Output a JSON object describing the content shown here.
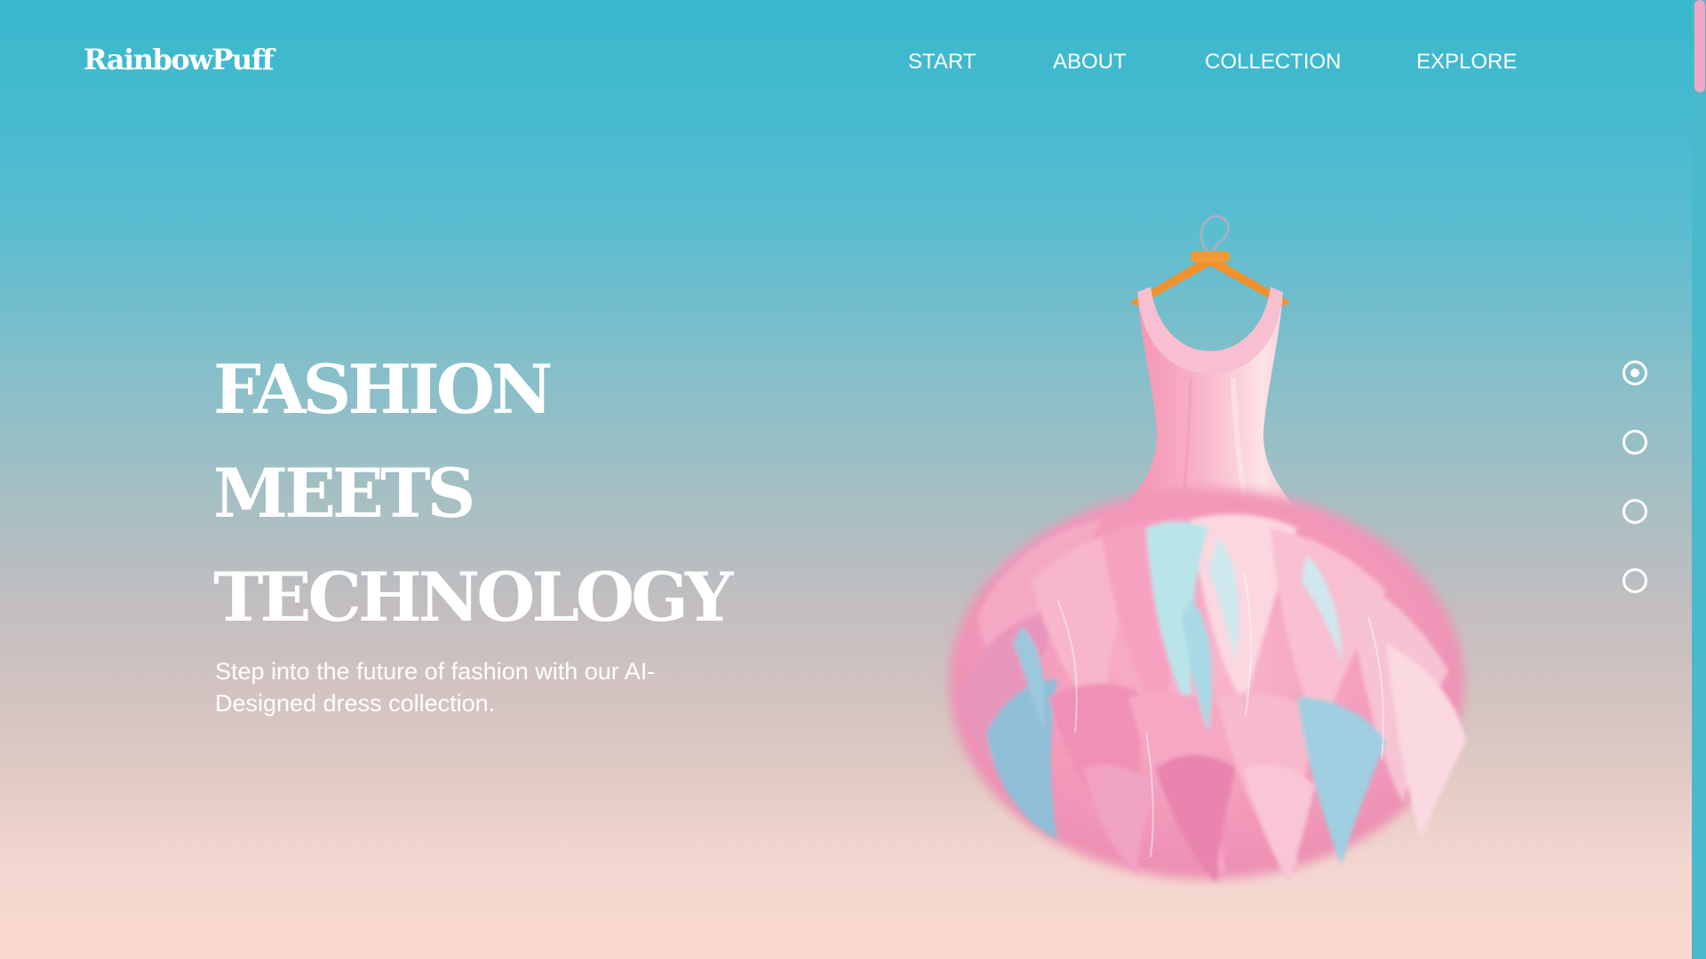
{
  "brand": {
    "name": "RainbowPuff"
  },
  "nav": {
    "items": [
      {
        "label": "START"
      },
      {
        "label": "ABOUT"
      },
      {
        "label": "COLLECTION"
      },
      {
        "label": "EXPLORE"
      }
    ]
  },
  "hero": {
    "headline_lines": [
      "FASHION",
      "MEETS",
      "TECHNOLOGY"
    ],
    "subtitle": "Step into the future of fashion with our AI-Designed dress collection."
  },
  "slider": {
    "count": 4,
    "active_index": 0
  },
  "colors": {
    "gradient_top": "#39b8cd",
    "gradient_bottom": "#fad9d2",
    "text": "#ffffff",
    "scroll_thumb": "#f2a7c4",
    "dress_pink": "#f7a9c4",
    "dress_blue": "#a8dce6",
    "hanger": "#f0912e"
  },
  "icons": {
    "dress_image": "feather-dress-on-hanger"
  }
}
